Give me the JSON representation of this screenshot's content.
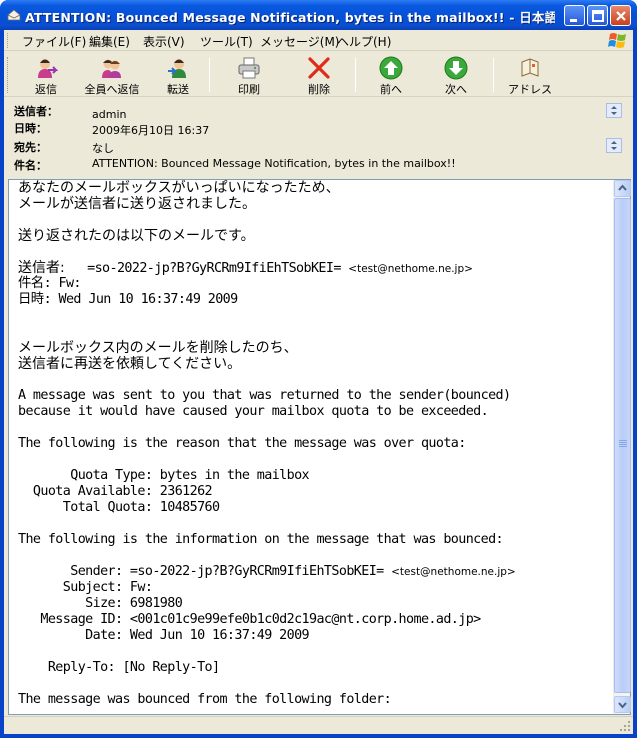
{
  "window": {
    "title": "ATTENTION: Bounced Message Notification, bytes in the mailbox!! - 日本語 (自..."
  },
  "menu": {
    "items": [
      "ファイル(F)",
      "編集(E)",
      "表示(V)",
      "ツール(T)",
      "メッセージ(M)",
      "ヘルプ(H)"
    ]
  },
  "toolbar": {
    "reply": "返信",
    "reply_all": "全員へ返信",
    "forward": "転送",
    "print": "印刷",
    "delete": "削除",
    "previous": "前へ",
    "next": "次へ",
    "addresses": "アドレス"
  },
  "header": {
    "from_label": "送信者：",
    "from_value": "admin",
    "date_label": "日時：",
    "date_value": "2009年6月10日 16:37",
    "to_label": "宛先：",
    "to_value": "なし",
    "subject_label": "件名：",
    "subject_value": "ATTENTION: Bounced Message Notification, bytes in the mailbox!!"
  },
  "body": {
    "l1": "あなたのメールボックスがいっぱいになったため、",
    "l2": "メールが送信者に送り返されました。",
    "l3": "送り返されたのは以下のメールです。",
    "l4_label": "送信者:",
    "l4_value": "   =so-2022-jp?B?GyRCRm9IfiEhTSobKEI= ",
    "l4_addr": "<test@nethome.ne.jp>",
    "l5": "件名: Fw:",
    "l6": "日時: Wed Jun 10 16:37:49 2009",
    "l7": "メールボックス内のメールを削除したのち、",
    "l8": "送信者に再送を依頼してください。",
    "l9": "A message was sent to you that was returned to the sender(bounced)",
    "l10": "because it would have caused your mailbox quota to be exceeded.",
    "l11": "The following is the reason that the message was over quota:",
    "l12": "       Quota Type: bytes in the mailbox",
    "l13": "  Quota Available: 2361262",
    "l14": "      Total Quota: 10485760",
    "l15": "The following is the information on the message that was bounced:",
    "l16": "       Sender: =so-2022-jp?B?GyRCRm9IfiEhTSobKEI= ",
    "l16_addr": "<test@nethome.ne.jp>",
    "l17": "      Subject: Fw:",
    "l18": "         Size: 6981980",
    "l19": "   Message ID: <001c01c9e99efe0b1c0d2c19ac@nt.corp.home.ad.jp>",
    "l20": "         Date: Wed Jun 10 16:37:49 2009",
    "l21": "    Reply-To: [No Reply-To]",
    "l22": "The message was bounced from the following folder:"
  },
  "colors": {
    "titlebar": "#0550d8",
    "chrome": "#ece9d8",
    "body_border": "#7f9db9"
  }
}
